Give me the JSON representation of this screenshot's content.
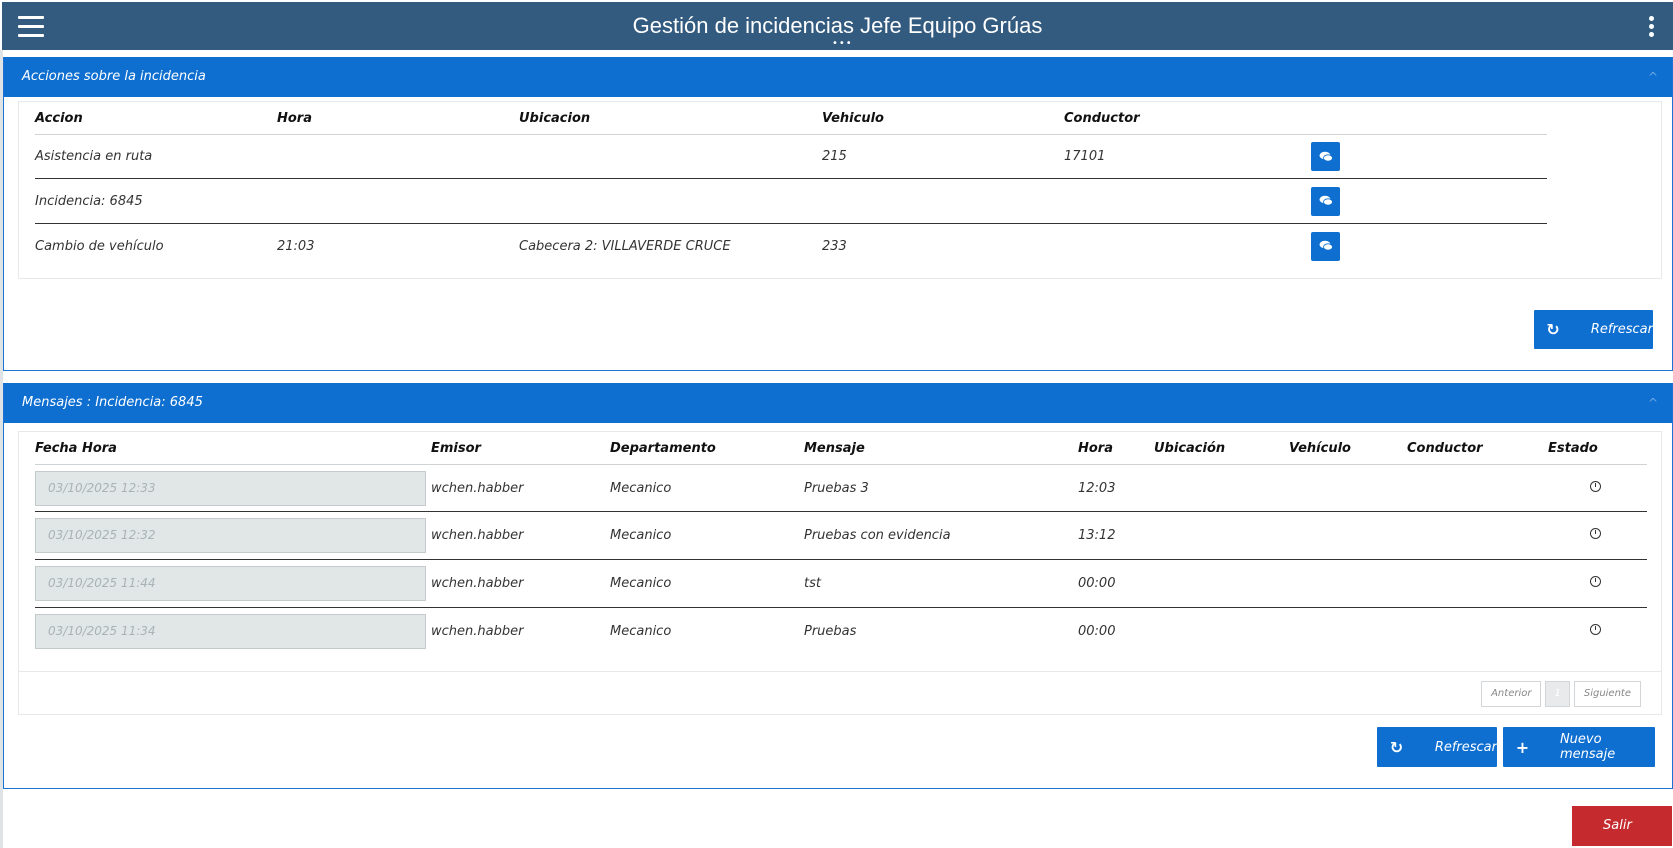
{
  "header": {
    "title": "Gestión de incidencias Jefe Equipo Grúas",
    "handle": "•••"
  },
  "acciones": {
    "title": "Acciones sobre la incidencia",
    "collapse_icon": "^",
    "columns": [
      "Accion",
      "Hora",
      "Ubicacion",
      "Vehiculo",
      "Conductor"
    ],
    "rows": [
      {
        "accion": "Asistencia en ruta",
        "hora": "",
        "ubicacion": "",
        "vehiculo": "215",
        "conductor": "17101"
      },
      {
        "accion": "Incidencia: 6845",
        "hora": "",
        "ubicacion": "",
        "vehiculo": "",
        "conductor": ""
      },
      {
        "accion": "Cambio de vehículo",
        "hora": "21:03",
        "ubicacion": "Cabecera 2: VILLAVERDE CRUCE",
        "vehiculo": "233",
        "conductor": ""
      }
    ],
    "refresh_label": "Refrescar"
  },
  "mensajes": {
    "title": "Mensajes : Incidencia: 6845",
    "collapse_icon": "^",
    "columns": [
      "Fecha Hora",
      "Emisor",
      "Departamento",
      "Mensaje",
      "Hora",
      "Ubicación",
      "Vehículo",
      "Conductor",
      "Estado"
    ],
    "rows": [
      {
        "fecha": "03/10/2025 12:33",
        "emisor": "wchen.habber",
        "departamento": "Mecanico",
        "mensaje": "Pruebas 3",
        "hora": "12:03"
      },
      {
        "fecha": "03/10/2025 12:32",
        "emisor": "wchen.habber",
        "departamento": "Mecanico",
        "mensaje": "Pruebas con evidencia",
        "hora": "13:12"
      },
      {
        "fecha": "03/10/2025 11:44",
        "emisor": "wchen.habber",
        "departamento": "Mecanico",
        "mensaje": "tst",
        "hora": "00:00"
      },
      {
        "fecha": "03/10/2025 11:34",
        "emisor": "wchen.habber",
        "departamento": "Mecanico",
        "mensaje": "Pruebas",
        "hora": "00:00"
      }
    ],
    "pager": {
      "prev": "Anterior",
      "page": "1",
      "next": "Siguiente"
    },
    "refresh_label": "Refrescar",
    "new_label": "Nuevo mensaje"
  },
  "exit_label": "Salir",
  "colors": {
    "header_bg": "#335b7f",
    "accent": "#0e6fd0",
    "danger": "#c52a2e"
  }
}
